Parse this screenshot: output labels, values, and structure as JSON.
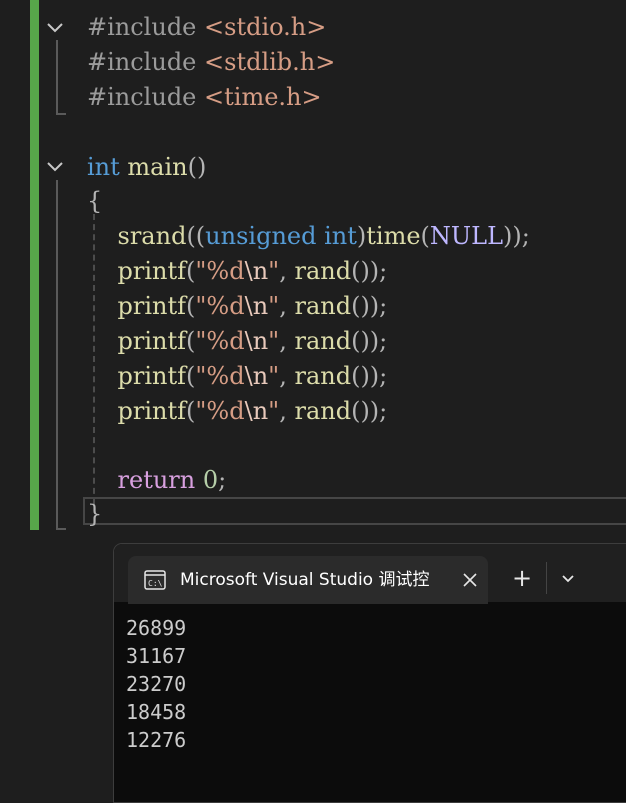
{
  "editor": {
    "lines": [
      [
        {
          "c": "t-pre",
          "t": "#include "
        },
        {
          "c": "t-str",
          "t": "<stdio.h>"
        }
      ],
      [
        {
          "c": "t-pre",
          "t": "#include "
        },
        {
          "c": "t-str",
          "t": "<stdlib.h>"
        }
      ],
      [
        {
          "c": "t-pre",
          "t": "#include "
        },
        {
          "c": "t-str",
          "t": "<time.h>"
        }
      ],
      [],
      [
        {
          "c": "t-kw",
          "t": "int"
        },
        {
          "c": "t-plain",
          "t": " "
        },
        {
          "c": "t-fn",
          "t": "main"
        },
        {
          "c": "t-punc",
          "t": "()"
        }
      ],
      [
        {
          "c": "t-punc",
          "t": "{"
        }
      ],
      [
        {
          "c": "t-plain",
          "t": "    "
        },
        {
          "c": "t-fn",
          "t": "srand"
        },
        {
          "c": "t-punc",
          "t": "(("
        },
        {
          "c": "t-kw",
          "t": "unsigned int"
        },
        {
          "c": "t-punc",
          "t": ")"
        },
        {
          "c": "t-fn",
          "t": "time"
        },
        {
          "c": "t-punc",
          "t": "("
        },
        {
          "c": "t-null",
          "t": "NULL"
        },
        {
          "c": "t-punc",
          "t": "));"
        }
      ],
      [
        {
          "c": "t-plain",
          "t": "    "
        },
        {
          "c": "t-fn",
          "t": "printf"
        },
        {
          "c": "t-punc",
          "t": "("
        },
        {
          "c": "t-str",
          "t": "\"%d"
        },
        {
          "c": "t-esc",
          "t": "\\n"
        },
        {
          "c": "t-str",
          "t": "\""
        },
        {
          "c": "t-punc",
          "t": ", "
        },
        {
          "c": "t-fn",
          "t": "rand"
        },
        {
          "c": "t-punc",
          "t": "());"
        }
      ],
      [
        {
          "c": "t-plain",
          "t": "    "
        },
        {
          "c": "t-fn",
          "t": "printf"
        },
        {
          "c": "t-punc",
          "t": "("
        },
        {
          "c": "t-str",
          "t": "\"%d"
        },
        {
          "c": "t-esc",
          "t": "\\n"
        },
        {
          "c": "t-str",
          "t": "\""
        },
        {
          "c": "t-punc",
          "t": ", "
        },
        {
          "c": "t-fn",
          "t": "rand"
        },
        {
          "c": "t-punc",
          "t": "());"
        }
      ],
      [
        {
          "c": "t-plain",
          "t": "    "
        },
        {
          "c": "t-fn",
          "t": "printf"
        },
        {
          "c": "t-punc",
          "t": "("
        },
        {
          "c": "t-str",
          "t": "\"%d"
        },
        {
          "c": "t-esc",
          "t": "\\n"
        },
        {
          "c": "t-str",
          "t": "\""
        },
        {
          "c": "t-punc",
          "t": ", "
        },
        {
          "c": "t-fn",
          "t": "rand"
        },
        {
          "c": "t-punc",
          "t": "());"
        }
      ],
      [
        {
          "c": "t-plain",
          "t": "    "
        },
        {
          "c": "t-fn",
          "t": "printf"
        },
        {
          "c": "t-punc",
          "t": "("
        },
        {
          "c": "t-str",
          "t": "\"%d"
        },
        {
          "c": "t-esc",
          "t": "\\n"
        },
        {
          "c": "t-str",
          "t": "\""
        },
        {
          "c": "t-punc",
          "t": ", "
        },
        {
          "c": "t-fn",
          "t": "rand"
        },
        {
          "c": "t-punc",
          "t": "());"
        }
      ],
      [
        {
          "c": "t-plain",
          "t": "    "
        },
        {
          "c": "t-fn",
          "t": "printf"
        },
        {
          "c": "t-punc",
          "t": "("
        },
        {
          "c": "t-str",
          "t": "\"%d"
        },
        {
          "c": "t-esc",
          "t": "\\n"
        },
        {
          "c": "t-str",
          "t": "\""
        },
        {
          "c": "t-punc",
          "t": ", "
        },
        {
          "c": "t-fn",
          "t": "rand"
        },
        {
          "c": "t-punc",
          "t": "());"
        }
      ],
      [],
      [
        {
          "c": "t-plain",
          "t": "    "
        },
        {
          "c": "t-ret",
          "t": "return"
        },
        {
          "c": "t-plain",
          "t": " "
        },
        {
          "c": "t-num",
          "t": "0"
        },
        {
          "c": "t-punc",
          "t": ";"
        }
      ],
      [
        {
          "c": "t-punc",
          "t": "}"
        }
      ]
    ],
    "colors": {
      "background": "#1e1e1e",
      "change_bar": "#57a64a",
      "keyword": "#569cd6",
      "function": "#dcdcaa",
      "string": "#d69d85",
      "preprocessor": "#9b9b9b",
      "return_keyword": "#d8a0df",
      "number": "#b5cea8"
    },
    "fold_icons": [
      "chevron-down-icon",
      "chevron-down-icon"
    ]
  },
  "terminal": {
    "tab_title": "Microsoft Visual Studio 调试控",
    "tab_icon": "console-icon",
    "close_icon": "close-icon",
    "new_tab_label": "+",
    "dropdown_icon": "chevron-down-icon",
    "output": [
      "26899",
      "31167",
      "23270",
      "18458",
      "12276"
    ],
    "colors": {
      "background": "#0c0c0c",
      "tab": "#2b2b2b",
      "text": "#cccccc"
    }
  }
}
